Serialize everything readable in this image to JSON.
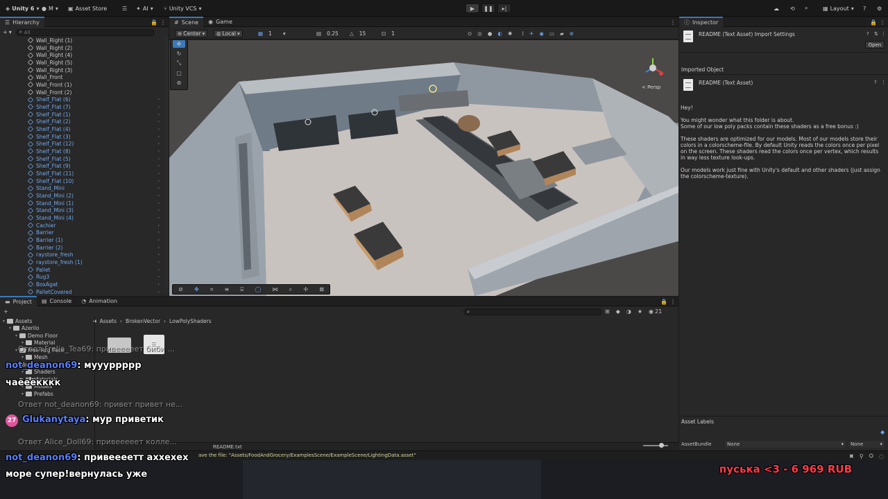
{
  "toolbar": {
    "account": "Unity 6",
    "user_initial": "M",
    "asset_store": "Asset Store",
    "ai": "AI",
    "vcs": "Unity VCS",
    "layout": "Layout"
  },
  "hierarchy": {
    "tab": "Hierarchy",
    "search_placeholder": "All",
    "items": [
      {
        "label": "Wall_Right (1)",
        "color": "gray"
      },
      {
        "label": "Wall_Right (2)",
        "color": "gray"
      },
      {
        "label": "Wall_Right (4)",
        "color": "gray"
      },
      {
        "label": "Wall_Right (5)",
        "color": "gray"
      },
      {
        "label": "Wall_Right (3)",
        "color": "gray"
      },
      {
        "label": "Wall_Front",
        "color": "gray"
      },
      {
        "label": "Wall_Front (1)",
        "color": "gray"
      },
      {
        "label": "Wall_Front (2)",
        "color": "gray"
      },
      {
        "label": "Shelf_Flat (6)",
        "color": "blue"
      },
      {
        "label": "Shelf_Flat (7)",
        "color": "blue"
      },
      {
        "label": "Shelf_Flat (1)",
        "color": "blue"
      },
      {
        "label": "Shelf_Flat (2)",
        "color": "blue"
      },
      {
        "label": "Shelf_Flat (4)",
        "color": "blue"
      },
      {
        "label": "Shelf_Flat (3)",
        "color": "blue"
      },
      {
        "label": "Shelf_Flat (12)",
        "color": "blue"
      },
      {
        "label": "Shelf_Flat (8)",
        "color": "blue"
      },
      {
        "label": "Shelf_Flat (5)",
        "color": "blue"
      },
      {
        "label": "Shelf_Flat (9)",
        "color": "blue"
      },
      {
        "label": "Shelf_Flat (11)",
        "color": "blue"
      },
      {
        "label": "Shelf_Flat (10)",
        "color": "blue"
      },
      {
        "label": "Stand_Mini",
        "color": "blue"
      },
      {
        "label": "Stand_Mini (2)",
        "color": "blue"
      },
      {
        "label": "Stand_Mini (1)",
        "color": "blue"
      },
      {
        "label": "Stand_Mini (3)",
        "color": "blue"
      },
      {
        "label": "Stand_Mini (4)",
        "color": "blue"
      },
      {
        "label": "Cachier",
        "color": "blue"
      },
      {
        "label": "Barrier",
        "color": "blue"
      },
      {
        "label": "Barrier (1)",
        "color": "blue"
      },
      {
        "label": "Barrier (2)",
        "color": "blue"
      },
      {
        "label": "raystore_fresh",
        "color": "blue"
      },
      {
        "label": "raystore_fresh (1)",
        "color": "blue"
      },
      {
        "label": "Pallet",
        "color": "blue"
      },
      {
        "label": "Rug3",
        "color": "blue"
      },
      {
        "label": "BoxAgat",
        "color": "blue"
      },
      {
        "label": "PalletCovered",
        "color": "blue"
      }
    ]
  },
  "scene": {
    "tab_scene": "Scene",
    "tab_game": "Game",
    "pivot": "Center",
    "space": "Local",
    "grid_value": "1",
    "snap_value": "0.25",
    "rotate_snap": "15",
    "scale_snap": "1",
    "persp_label": "< Persp"
  },
  "project": {
    "tab_project": "Project",
    "tab_console": "Console",
    "tab_animation": "Animation",
    "breadcrumb": [
      "Assets",
      "BrokenVector",
      "LowPolyShaders"
    ],
    "hidden_count": "21",
    "tree": [
      {
        "label": "Assets",
        "indent": 0
      },
      {
        "label": "Azerilo",
        "indent": 1
      },
      {
        "label": "Demo Floor",
        "indent": 2
      },
      {
        "label": "Material",
        "indent": 3
      },
      {
        "label": "Free Rug Pack",
        "indent": 2
      },
      {
        "label": "Mesh",
        "indent": 3
      },
      {
        "label": "BrokenVector",
        "indent": 1
      },
      {
        "label": "Shaders",
        "indent": 3
      },
      {
        "label": "Materials",
        "indent": 3
      },
      {
        "label": "Models",
        "indent": 3
      },
      {
        "label": "Prefabs",
        "indent": 3
      }
    ],
    "selected_path": "README.txt"
  },
  "inspector": {
    "tab": "Inspector",
    "title": "README (Text Asset) Import Settings",
    "open_button": "Open",
    "imported_object": "Imported Object",
    "asset_title": "README (Text Asset)",
    "body": [
      "Hey!",
      "You might wonder what this folder is about.",
      "Some of our low poly packs contain these shaders as a free bonus :)",
      "These shaders are optimized for our models. Most of our models store their colors in a colorscheme-file. By default Unity reads the colors once per pixel on the screen. These shaders read the colors once per vertex, which results in way less texture look-ups.",
      "Our models work just fine with Unity's default and other shaders (just assign the colorscheme-texture)."
    ],
    "asset_labels": "Asset Labels",
    "asset_bundle_label": "AssetBundle",
    "asset_bundle_value": "None",
    "asset_bundle_variant": "None"
  },
  "status": {
    "message": "ave the file: \"Assets/FoodAndGrocery/ExamplesScene/ExampleScene/LightingData.asset\""
  },
  "stream": {
    "chat": [
      {
        "type": "reply",
        "text": "Ответ Frelia_Tea69: привееееет биби ..."
      },
      {
        "type": "msg",
        "nick": "not_deanon69",
        "text": "муууррррр"
      },
      {
        "type": "plain",
        "text": "чаёёёкккк"
      },
      {
        "type": "reply",
        "text": "Ответ not_deanon69: привет привет не..."
      },
      {
        "type": "msg",
        "nick": "Glukanytaya",
        "text": "мур приветик",
        "badge": "27"
      },
      {
        "type": "reply",
        "text": "Ответ Alice_Doll69: привееееет колле..."
      },
      {
        "type": "msg",
        "nick": "not_deanon69",
        "text": "привееeетт аххехех"
      },
      {
        "type": "plain",
        "text": "море супер!вернулась уже"
      }
    ],
    "donation": "пуська <3 - 6 969 RUB"
  }
}
